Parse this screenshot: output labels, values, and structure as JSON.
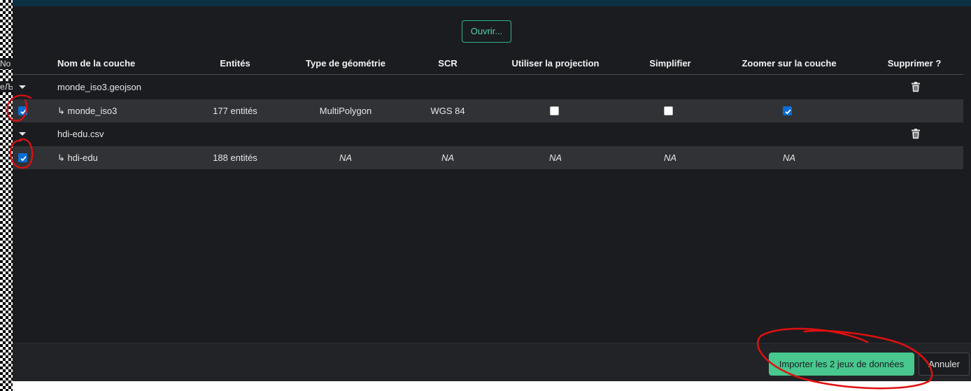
{
  "side_fragments": {
    "top": "No",
    "mid": "eЉ"
  },
  "open_button": "Ouvrir...",
  "columns": {
    "layer_name": "Nom de la couche",
    "entities": "Entités",
    "geometry_type": "Type de géométrie",
    "crs": "SCR",
    "use_projection": "Utiliser la projection",
    "simplify": "Simplifier",
    "zoom_to_layer": "Zoomer sur la couche",
    "delete": "Supprimer ?"
  },
  "datasets": [
    {
      "file": "monde_iso3.geojson",
      "layer": {
        "name": "↳ monde_iso3",
        "selected": true,
        "entities": "177 entités",
        "geometry_type": "MultiPolygon",
        "crs": "WGS 84",
        "use_projection": false,
        "simplify": false,
        "zoom_to_layer": true
      }
    },
    {
      "file": "hdi-edu.csv",
      "layer": {
        "name": "↳ hdi-edu",
        "selected": true,
        "entities": "188 entités",
        "geometry_type": "NA",
        "crs": "NA",
        "use_projection": "NA",
        "simplify": "NA",
        "zoom_to_layer": "NA"
      }
    }
  ],
  "footer": {
    "import_button": "Importer les 2 jeux de données",
    "cancel_button": "Annuler"
  },
  "colors": {
    "background": "#1b1c20",
    "row_highlight": "#303236",
    "primary_button": "#48c78e",
    "checkbox_checked": "#0b6cd6",
    "annotation": "#e01010"
  }
}
